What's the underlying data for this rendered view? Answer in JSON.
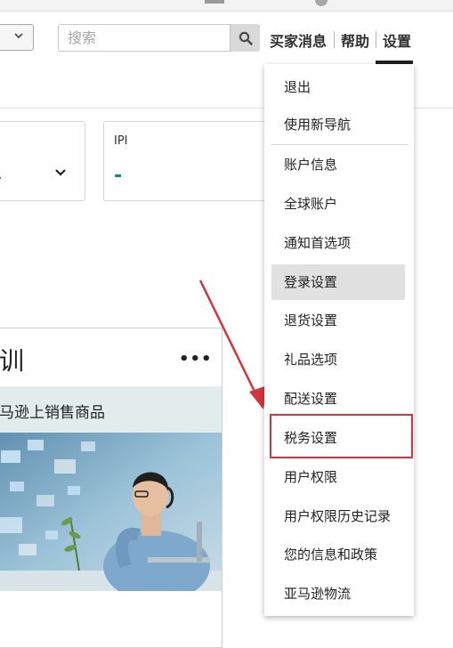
{
  "header": {
    "search": {
      "placeholder": "搜索",
      "value": ""
    },
    "nav": {
      "buyer_messages": "买家消息",
      "help": "帮助",
      "settings": "设置"
    }
  },
  "cards": [
    {
      "label": "",
      "value": ""
    },
    {
      "label": "IPI",
      "value": "-"
    }
  ],
  "training_panel": {
    "title": "训",
    "more": "•••",
    "banner_text": "马逊上销售商品"
  },
  "settings_menu": {
    "items": [
      "退出",
      "使用新导航",
      "账户信息",
      "全球账户",
      "通知首选项",
      "登录设置",
      "退货设置",
      "礼品选项",
      "配送设置",
      "税务设置",
      "用户权限",
      "用户权限历史记录",
      "您的信息和政策",
      "亚马逊物流"
    ],
    "hovered_item": "登录设置",
    "highlighted_item": "税务设置"
  },
  "colors": {
    "accent_teal": "#0e8a7f",
    "annotation_red": "#d5343e",
    "menu_hover": "#e1e1e1"
  },
  "icons": [
    "chevron-down-icon",
    "search-icon",
    "more-icon",
    "arrow-annotation"
  ]
}
